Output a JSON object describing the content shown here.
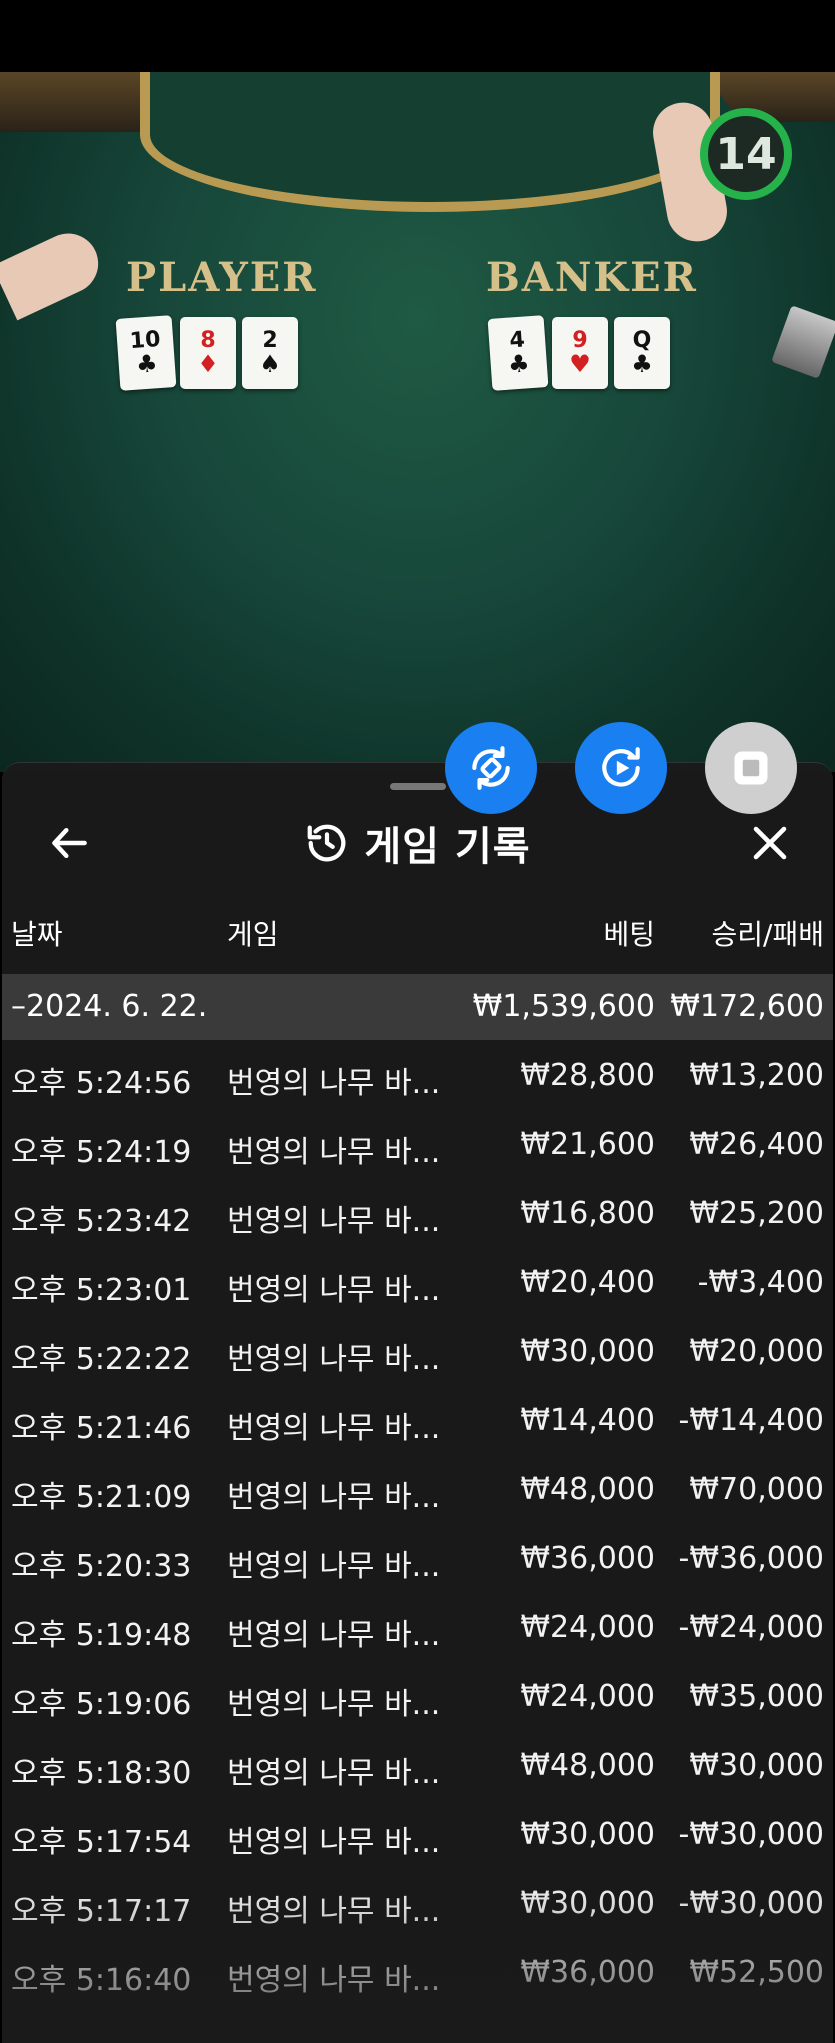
{
  "video": {
    "timer": "14",
    "player_label": "PLAYER",
    "banker_label": "BANKER",
    "player_cards": [
      {
        "rank": "10",
        "suit": "♣",
        "color": "#111111"
      },
      {
        "rank": "8",
        "suit": "♦",
        "color": "#d32020"
      },
      {
        "rank": "2",
        "suit": "♠",
        "color": "#111111"
      }
    ],
    "banker_cards": [
      {
        "rank": "4",
        "suit": "♣",
        "color": "#111111"
      },
      {
        "rank": "9",
        "suit": "♥",
        "color": "#d32020"
      },
      {
        "rank": "Q",
        "suit": "♣",
        "color": "#111111"
      }
    ]
  },
  "fabs": {
    "rotate_icon": "rotate-device-icon",
    "replay_icon": "replay-icon",
    "stop_icon": "stop-icon"
  },
  "panel": {
    "title": "게임 기록",
    "title_icon": "history-icon",
    "back_icon": "arrow-left-icon",
    "close_icon": "close-icon",
    "columns": {
      "date": "날짜",
      "game": "게임",
      "bet": "베팅",
      "result": "승리/패배"
    },
    "summary": {
      "date": "–2024. 6. 22.",
      "bet": "₩1,539,600",
      "result": "₩172,600"
    },
    "rows": [
      {
        "time": "오후 5:24:56",
        "game": "번영의 나무 바...",
        "bet": "₩28,800",
        "result": "₩13,200"
      },
      {
        "time": "오후 5:24:19",
        "game": "번영의 나무 바...",
        "bet": "₩21,600",
        "result": "₩26,400"
      },
      {
        "time": "오후 5:23:42",
        "game": "번영의 나무 바...",
        "bet": "₩16,800",
        "result": "₩25,200"
      },
      {
        "time": "오후 5:23:01",
        "game": "번영의 나무 바...",
        "bet": "₩20,400",
        "result": "-₩3,400"
      },
      {
        "time": "오후 5:22:22",
        "game": "번영의 나무 바...",
        "bet": "₩30,000",
        "result": "₩20,000"
      },
      {
        "time": "오후 5:21:46",
        "game": "번영의 나무 바...",
        "bet": "₩14,400",
        "result": "-₩14,400"
      },
      {
        "time": "오후 5:21:09",
        "game": "번영의 나무 바...",
        "bet": "₩48,000",
        "result": "₩70,000"
      },
      {
        "time": "오후 5:20:33",
        "game": "번영의 나무 바...",
        "bet": "₩36,000",
        "result": "-₩36,000"
      },
      {
        "time": "오후 5:19:48",
        "game": "번영의 나무 바...",
        "bet": "₩24,000",
        "result": "-₩24,000"
      },
      {
        "time": "오후 5:19:06",
        "game": "번영의 나무 바...",
        "bet": "₩24,000",
        "result": "₩35,000"
      },
      {
        "time": "오후 5:18:30",
        "game": "번영의 나무 바...",
        "bet": "₩48,000",
        "result": "₩30,000"
      },
      {
        "time": "오후 5:17:54",
        "game": "번영의 나무 바...",
        "bet": "₩30,000",
        "result": "-₩30,000"
      },
      {
        "time": "오후 5:17:17",
        "game": "번영의 나무 바...",
        "bet": "₩30,000",
        "result": "-₩30,000"
      },
      {
        "time": "오후 5:16:40",
        "game": "번영의 나무 바...",
        "bet": "₩36,000",
        "result": "₩52,500"
      }
    ]
  },
  "colors": {
    "accent_blue": "#1a7ff0",
    "timer_green": "#25b24a",
    "panel_bg": "#1a1a1a",
    "summary_bg": "#3a3a3a"
  }
}
